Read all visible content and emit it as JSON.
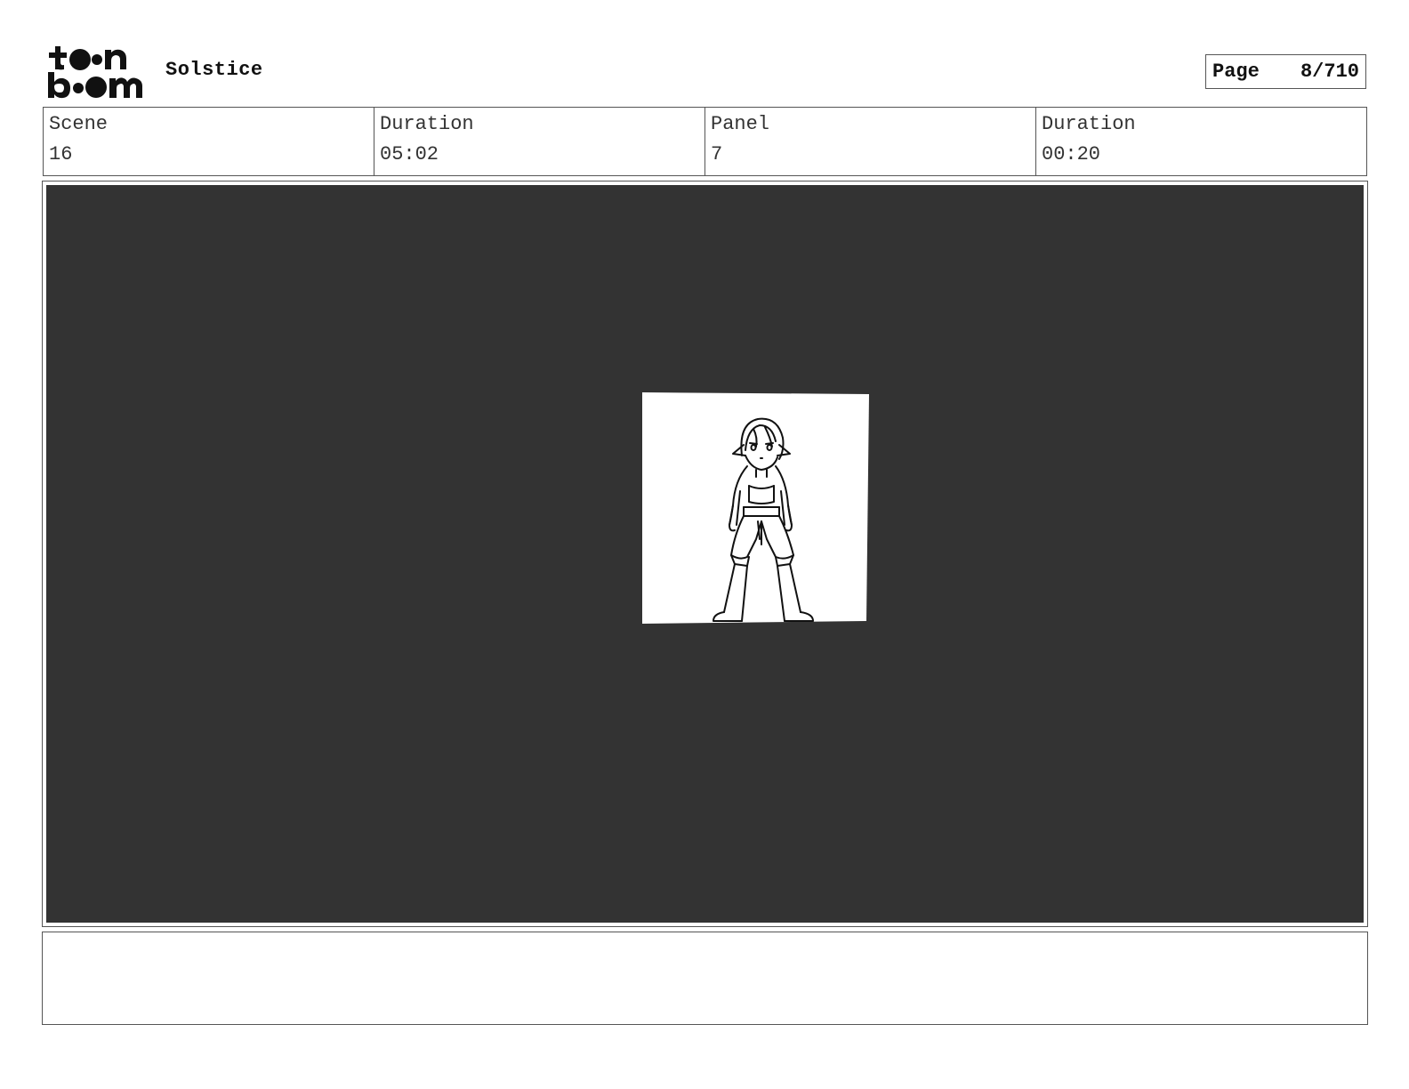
{
  "header": {
    "logo_alt": "toon boom",
    "project_title": "Solstice",
    "page_label": "Page",
    "page_value": "8/710"
  },
  "info": {
    "scene_label": "Scene",
    "scene_value": "16",
    "scene_duration_label": "Duration",
    "scene_duration_value": "05:02",
    "panel_label": "Panel",
    "panel_value": "7",
    "panel_duration_label": "Duration",
    "panel_duration_value": "00:20"
  },
  "panel": {
    "background_color": "#333333",
    "artwork": "character-sketch-low-angle"
  },
  "notes": {
    "text": ""
  }
}
